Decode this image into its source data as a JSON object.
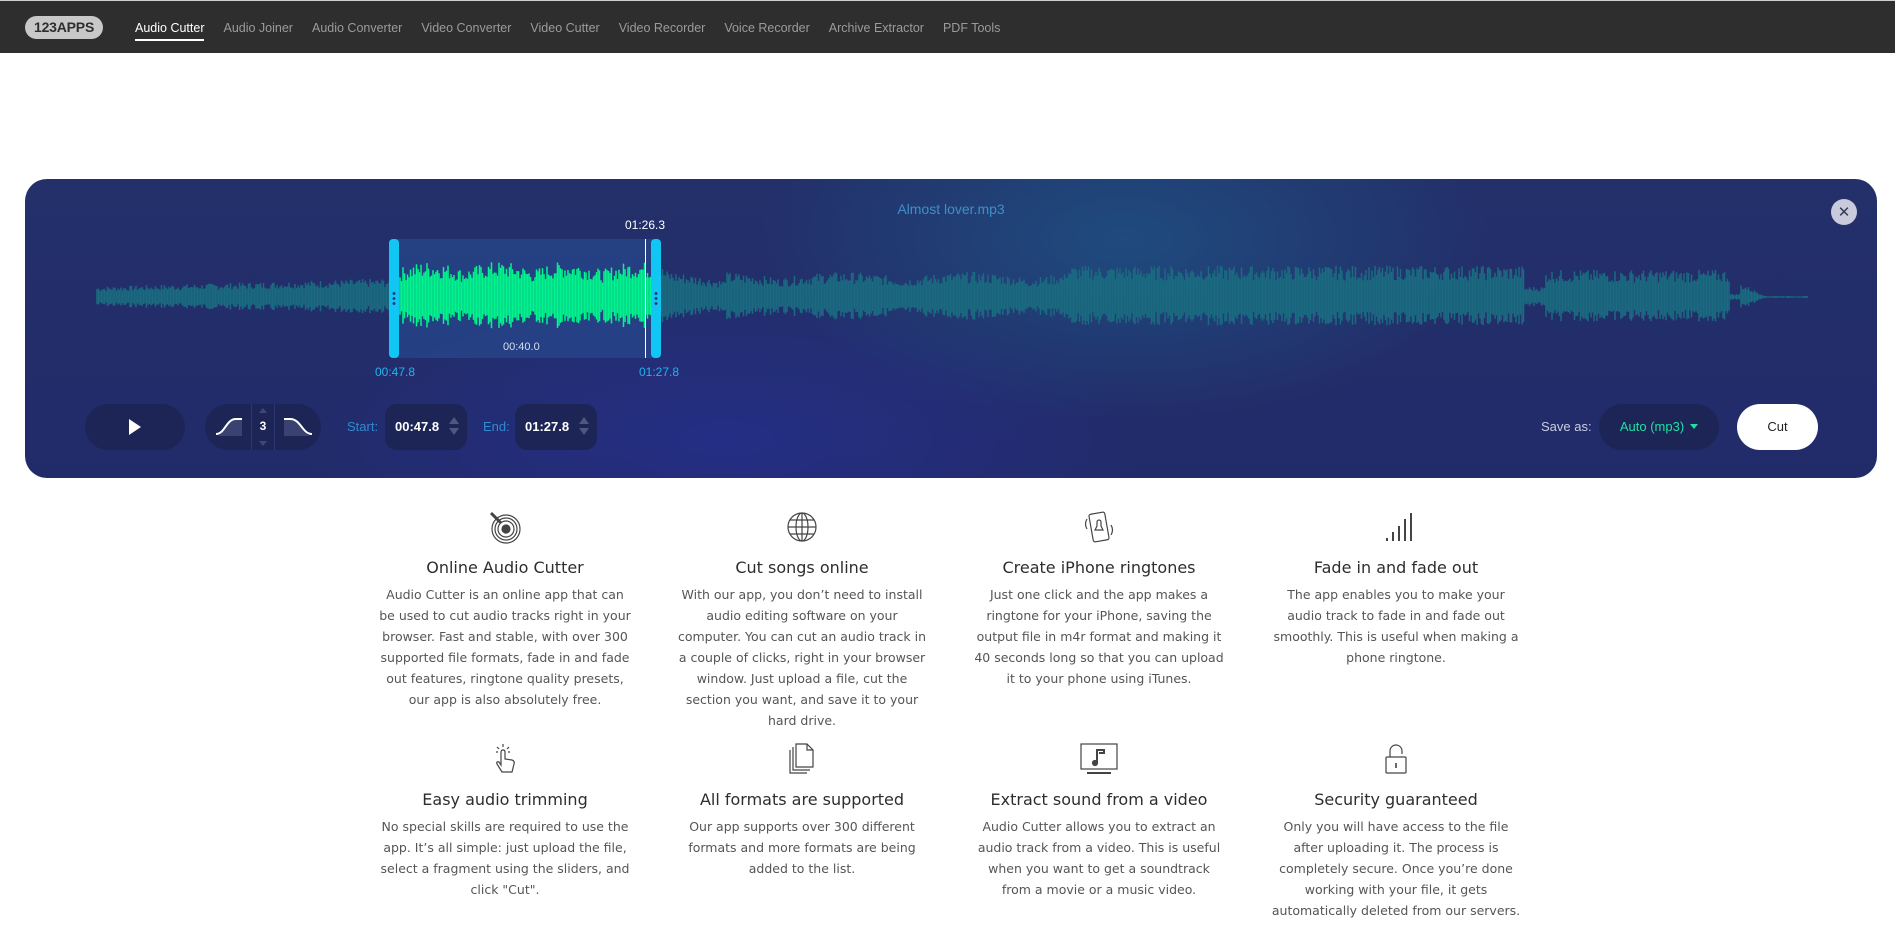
{
  "nav": {
    "logo": "123APPS",
    "items": [
      {
        "label": "Audio Cutter",
        "active": true
      },
      {
        "label": "Audio Joiner",
        "active": false
      },
      {
        "label": "Audio Converter",
        "active": false
      },
      {
        "label": "Video Converter",
        "active": false
      },
      {
        "label": "Video Cutter",
        "active": false
      },
      {
        "label": "Video Recorder",
        "active": false
      },
      {
        "label": "Voice Recorder",
        "active": false
      },
      {
        "label": "Archive Extractor",
        "active": false
      },
      {
        "label": "PDF Tools",
        "active": false
      }
    ]
  },
  "editor": {
    "filename": "Almost lover.mp3",
    "close_icon": "close-icon",
    "playhead_time": "01:26.3",
    "selection_duration": "00:40.0",
    "selection_start_marker": "00:47.8",
    "selection_end_marker": "01:27.8",
    "selection_range_fraction": [
      0.172,
      0.328
    ],
    "playhead_fraction": 0.316,
    "colors": {
      "waveform_selected": "#00f58c",
      "waveform_unselected": "#1a6a80",
      "handles": "#12c6f4",
      "format_text": "#1fe0a0"
    },
    "controls": {
      "play_icon": "play-icon",
      "fade_in_icon": "fade-in-icon",
      "fade_out_icon": "fade-out-icon",
      "fade_duration": "3",
      "start_label": "Start:",
      "start_value": "00:47.8",
      "end_label": "End:",
      "end_value": "01:27.8",
      "save_as_label": "Save as:",
      "format_value": "Auto (mp3)",
      "cut_label": "Cut"
    }
  },
  "features": [
    {
      "icon": "vinyl-record-icon",
      "title": "Online Audio Cutter",
      "text": "Audio Cutter is an online app that can be used to cut audio tracks right in your browser. Fast and stable, with over 300 supported file formats, fade in and fade out features, ringtone quality presets, our app is also absolutely free."
    },
    {
      "icon": "globe-icon",
      "title": "Cut songs online",
      "text": "With our app, you don’t need to install audio editing software on your computer. You can cut an audio track in a couple of clicks, right in your browser window. Just upload a file, cut the section you want, and save it to your hard drive."
    },
    {
      "icon": "phone-ringing-icon",
      "title": "Create iPhone ringtones",
      "text": "Just one click and the app makes a ringtone for your iPhone, saving the output file in m4r format and making it 40 seconds long so that you can upload it to your phone using iTunes."
    },
    {
      "icon": "volume-bars-icon",
      "title": "Fade in and fade out",
      "text": "The app enables you to make your audio track to fade in and fade out smoothly. This is useful when making a phone ringtone."
    },
    {
      "icon": "tap-hand-icon",
      "title": "Easy audio trimming",
      "text": "No special skills are required to use the app. It’s all simple: just upload the file, select a fragment using the sliders, and click \"Cut\"."
    },
    {
      "icon": "documents-icon",
      "title": "All formats are supported",
      "text": "Our app supports over 300 different formats and more formats are being added to the list."
    },
    {
      "icon": "monitor-music-icon",
      "title": "Extract sound from a video",
      "text": "Audio Cutter allows you to extract an audio track from a video. This is useful when you want to get a soundtrack from a movie or a music video."
    },
    {
      "icon": "padlock-icon",
      "title": "Security guaranteed",
      "text": "Only you will have access to the file after uploading it. The process is completely secure. Once you’re done working with your file, it gets automatically deleted from our servers."
    }
  ]
}
